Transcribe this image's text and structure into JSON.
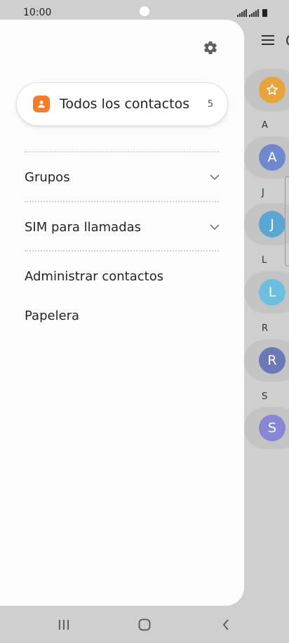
{
  "status_bar": {
    "time": "10:00"
  },
  "background_list": {
    "section_letters": [
      "A",
      "J",
      "L",
      "R",
      "S"
    ],
    "avatars": [
      {
        "initial": "",
        "color": "#e8a33c",
        "icon": "star-icon"
      },
      {
        "initial": "A",
        "color": "#6f89cf"
      },
      {
        "initial": "J",
        "color": "#5aa7d6"
      },
      {
        "initial": "L",
        "color": "#6dbfe0"
      },
      {
        "initial": "R",
        "color": "#6b79b8"
      },
      {
        "initial": "S",
        "color": "#8a86d6"
      }
    ]
  },
  "drawer": {
    "all_contacts": {
      "label": "Todos los contactos",
      "count": "5"
    },
    "menu": {
      "groups": "Grupos",
      "sim_calls": "SIM para llamadas",
      "manage_contacts": "Administrar contactos",
      "trash": "Papelera"
    }
  },
  "colors": {
    "accent": "#f57c2a",
    "drawer_bg": "#fcfcfc",
    "scrim": "#cfcfcf"
  }
}
